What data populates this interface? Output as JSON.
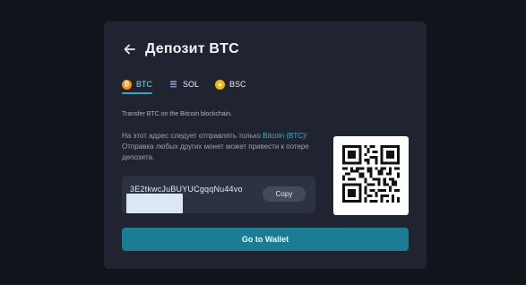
{
  "header": {
    "title": "Депозит BTC",
    "back_icon": "arrow-left-icon"
  },
  "tabs": [
    {
      "label": "BTC",
      "icon": "bitcoin-icon",
      "color": "#f7931a",
      "glyph": "₿",
      "active": true
    },
    {
      "label": "SOL",
      "icon": "solana-icon",
      "color": "#1f2330",
      "glyph": "",
      "active": false
    },
    {
      "label": "BSC",
      "icon": "bnb-icon",
      "color": "#f0b90b",
      "glyph": "",
      "active": false
    }
  ],
  "network_note": "Transfer BTC on the Bitcoin blockchain.",
  "warning": {
    "part1": "На этот адрес следует отправлять только ",
    "highlight": "Bitcoin (BTC)!",
    "part2": " Отправка любых других монет может привести к потере депозита."
  },
  "address": {
    "value": "3E2tkwcJuBUYUCgqqNu44vo",
    "copy_label": "Copy"
  },
  "qr": {
    "icon": "qr-code-icon"
  },
  "action": {
    "label": "Go to Wallet"
  },
  "colors": {
    "accent": "#2ea7c4",
    "button": "#1a7d93",
    "card": "#202431",
    "background": "#12141b"
  }
}
